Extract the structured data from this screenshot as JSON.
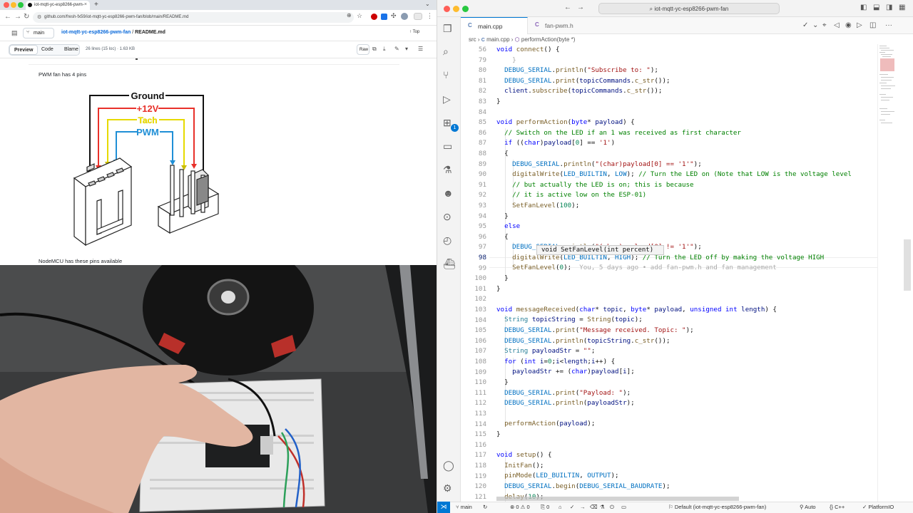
{
  "browser": {
    "tab_title": "iot-mqtt-yc-esp8266-pwm-",
    "url": "github.com/fresh-fx59/iot-mqtt-yc-esp8266-pwm-fan/blob/main/README.md",
    "branch": "main",
    "repo_link": "iot-mqtt-yc-esp8266-pwm-fan",
    "file_name": "README.md",
    "crumb_sep": "/",
    "top_label": "Top",
    "tabs": [
      "Preview",
      "Code",
      "Blame"
    ],
    "file_meta": "26 lines (15 loc) · 1.63 KB",
    "raw_label": "Raw",
    "readme_text1": "PWM fan has 4 pins",
    "readme_text2": "NodeMCU has these pins available",
    "diagram": {
      "ground": "Ground",
      "v12": "+12V",
      "tach": "Tach",
      "pwm": "PWM"
    }
  },
  "vscode": {
    "command_center": "iot-mqtt-yc-esp8266-pwm-fan",
    "tabs": [
      {
        "label": "main.cpp",
        "active": true
      },
      {
        "label": "fan-pwm.h",
        "active": false
      }
    ],
    "breadcrumb": [
      "src",
      "main.cpp",
      "performAction(byte *)"
    ],
    "tooltip": "void SetFanLevel(int percent)",
    "inline_blame": "You, 5 days ago • add fan-pwm.h and fan management",
    "line_numbers": [
      "56",
      "79",
      "80",
      "81",
      "82",
      "83",
      "84",
      "85",
      "86",
      "87",
      "88",
      "89",
      "90",
      "91",
      "92",
      "93",
      "94",
      "95",
      "96",
      "97",
      "98",
      "99",
      "100",
      "101",
      "102",
      "103",
      "104",
      "105",
      "106",
      "107",
      "108",
      "109",
      "110",
      "111",
      "112",
      "113",
      "114",
      "115",
      "116",
      "117",
      "118",
      "119",
      "120",
      "121"
    ],
    "current_line": "98",
    "activity_badges": {
      "extensions": "1"
    },
    "status": {
      "branch": "main",
      "sync": "↻",
      "errors": "0",
      "warnings": "0",
      "ports": "0",
      "env": "Default (iot-mqtt-yc-esp8266-pwm-fan)",
      "auto": "Auto",
      "lang": "C++",
      "platform": "PlatformIO"
    }
  },
  "colors": {
    "accent": "#0078d4",
    "link": "#0969da",
    "red": "#e8312a",
    "yellow": "#f5e400",
    "blue": "#1f8fd6"
  }
}
